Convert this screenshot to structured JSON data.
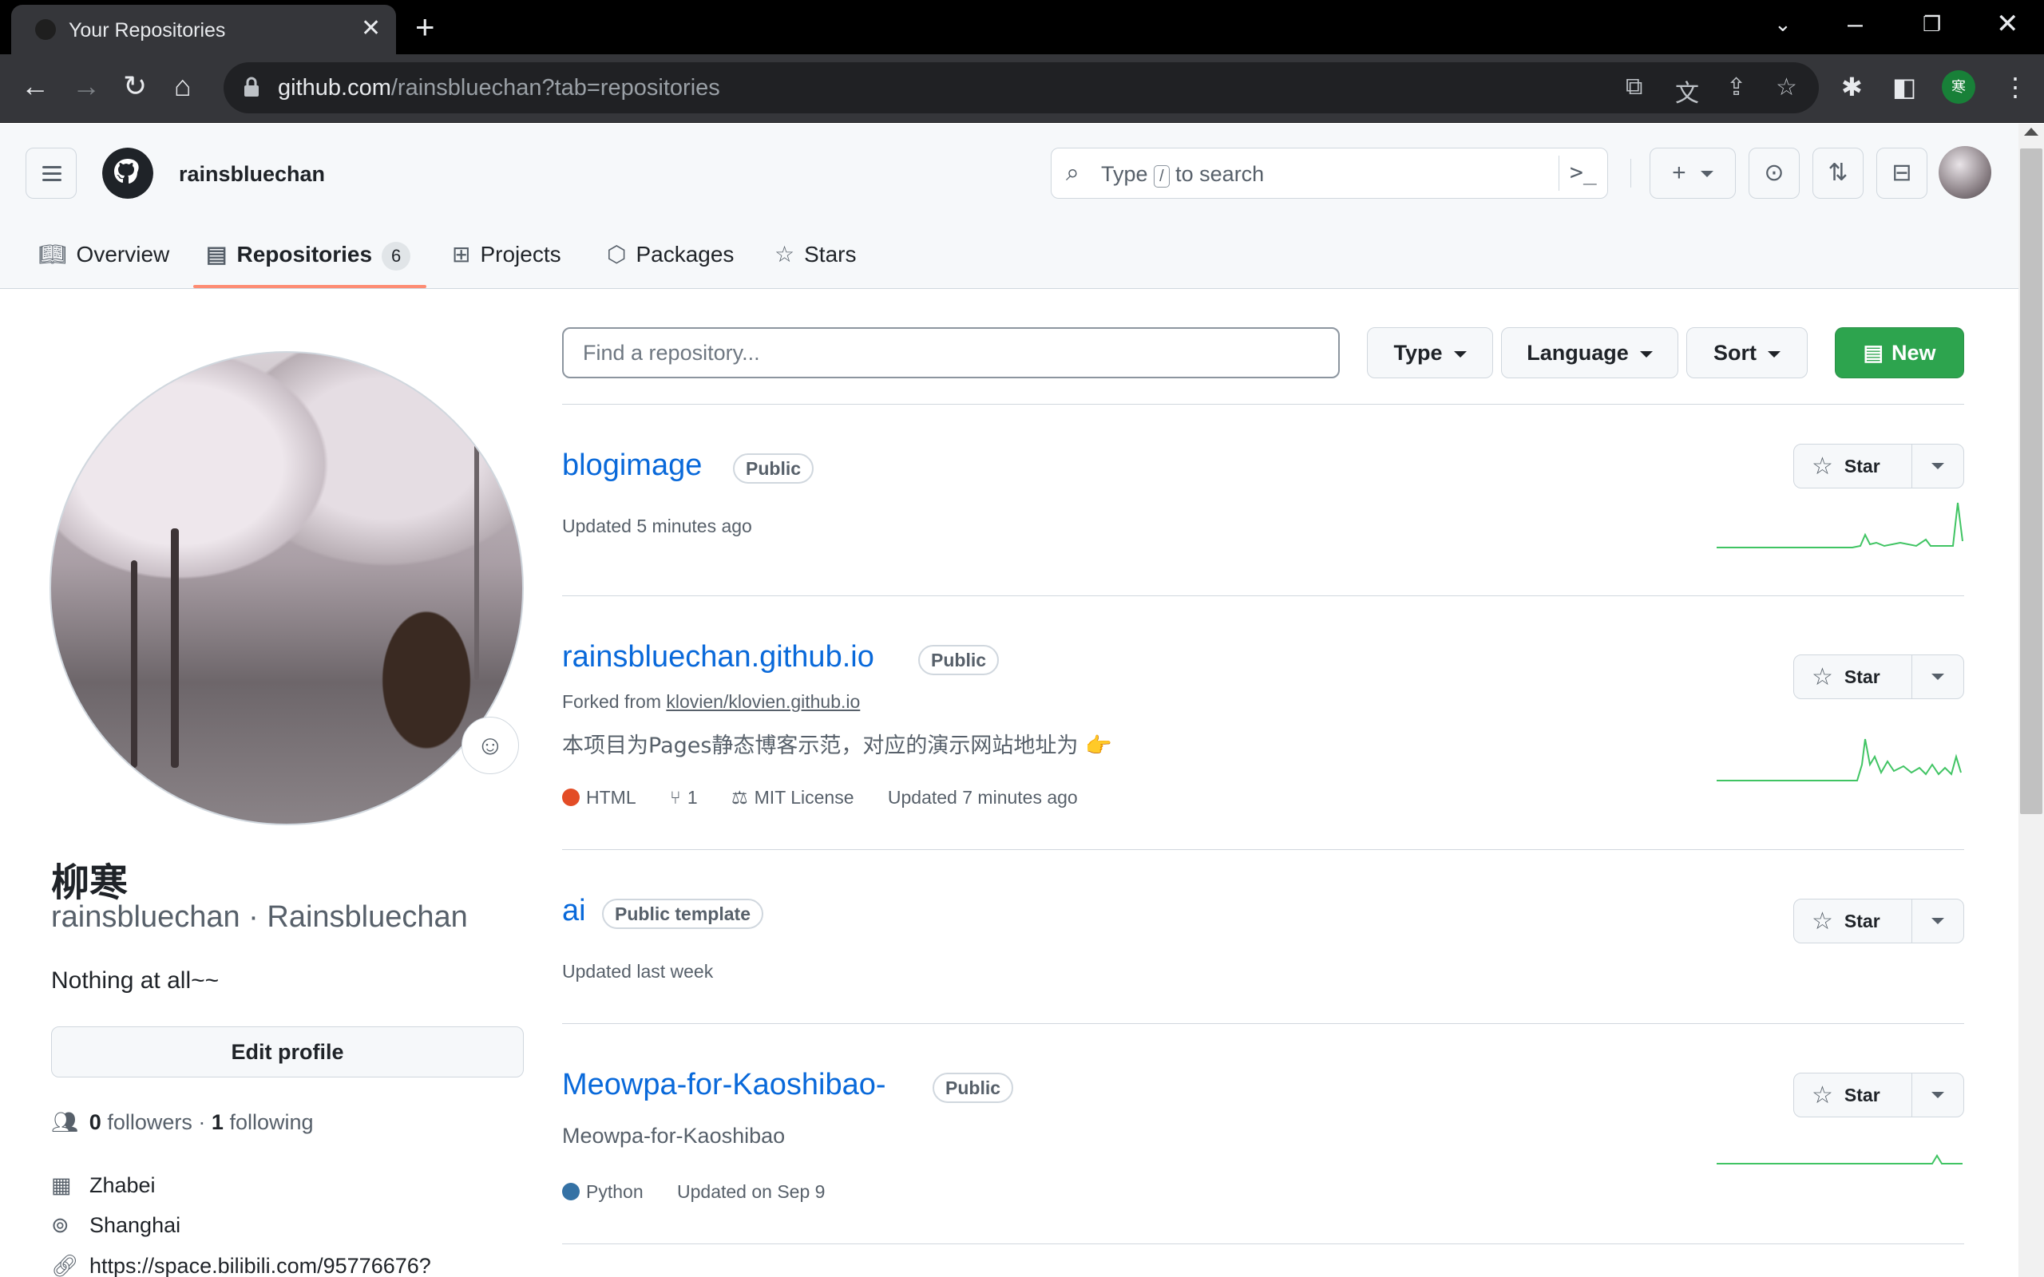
{
  "browser": {
    "tab_title": "Your Repositories",
    "url_host": "github.com",
    "url_path": "/rainsbluechan?tab=repositories",
    "profile_initial": "寒"
  },
  "header": {
    "username": "rainsbluechan",
    "search_prefix": "Type",
    "search_key": "/",
    "search_suffix": "to search"
  },
  "nav": {
    "tabs": [
      {
        "label": "Overview",
        "icon": "book-icon"
      },
      {
        "label": "Repositories",
        "icon": "repo-icon",
        "count": "6"
      },
      {
        "label": "Projects",
        "icon": "table-icon"
      },
      {
        "label": "Packages",
        "icon": "package-icon"
      },
      {
        "label": "Stars",
        "icon": "star-icon"
      }
    ]
  },
  "profile": {
    "name": "柳寒",
    "login": "rainsbluechan · Rainsbluechan",
    "bio": "Nothing at all~~",
    "edit_label": "Edit profile",
    "followers_count": "0",
    "followers_label": "followers",
    "following_count": "1",
    "following_label": "following",
    "company": "Zhabei",
    "location": "Shanghai",
    "website": "https://space.bilibili.com/95776676?"
  },
  "filters": {
    "search_placeholder": "Find a repository...",
    "type_label": "Type",
    "language_label": "Language",
    "sort_label": "Sort",
    "new_label": "New"
  },
  "repos": [
    {
      "name": "blogimage",
      "visibility": "Public",
      "updated": "Updated 5 minutes ago",
      "star_label": "Star"
    },
    {
      "name": "rainsbluechan.github.io",
      "visibility": "Public",
      "forked_prefix": "Forked from",
      "forked_from": "klovien/klovien.github.io",
      "description": "本项目为Pages静态博客示范，对应的演示网站地址为 👉",
      "language": "HTML",
      "language_color": "#e34c26",
      "forks": "1",
      "license": "MIT License",
      "updated": "Updated 7 minutes ago",
      "star_label": "Star"
    },
    {
      "name": "ai",
      "visibility": "Public template",
      "updated": "Updated last week",
      "star_label": "Star"
    },
    {
      "name": "Meowpa-for-Kaoshibao-",
      "visibility": "Public",
      "description": "Meowpa-for-Kaoshibao",
      "language": "Python",
      "language_color": "#3572A5",
      "updated": "Updated on Sep 9",
      "star_label": "Star"
    }
  ],
  "colors": {
    "accent_green": "#2da44e",
    "link_blue": "#0969da",
    "tab_underline": "#fd8c73"
  }
}
